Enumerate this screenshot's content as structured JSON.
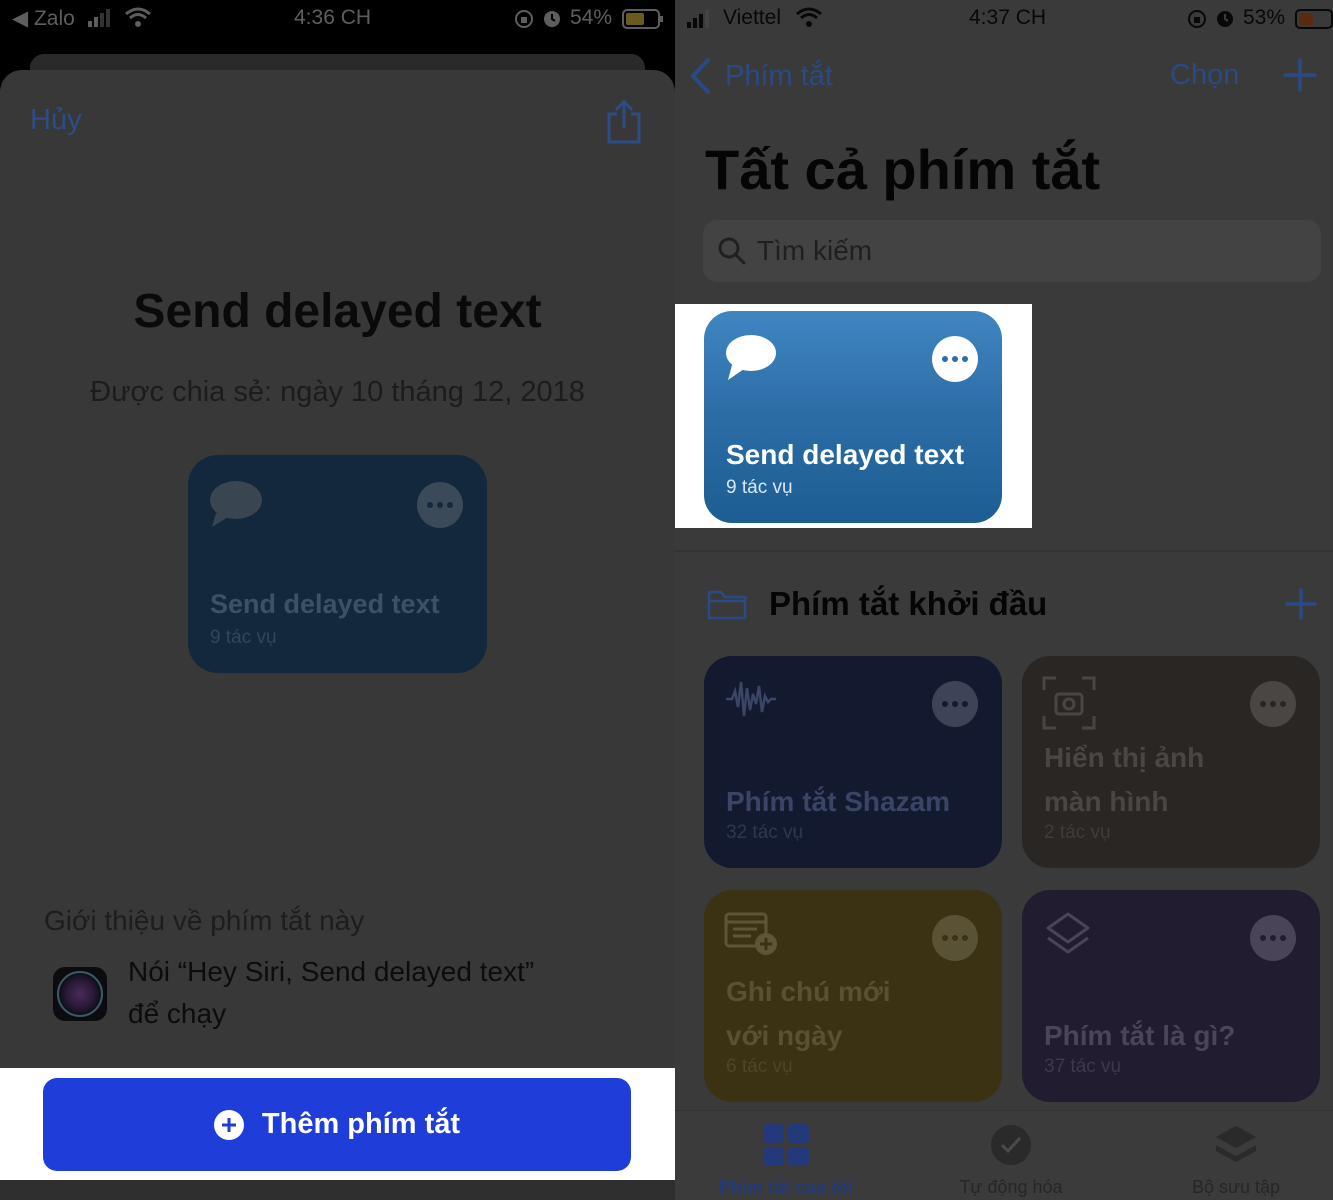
{
  "left": {
    "status": {
      "carrier": "◀ Zalo",
      "time": "4:36 CH",
      "battery": "54%"
    },
    "cancel_label": "Hủy",
    "title": "Send delayed text",
    "shared_date": "Được chia sẻ: ngày 10 tháng 12, 2018",
    "preview_card": {
      "name": "Send delayed text",
      "count": "9 tác vụ"
    },
    "about_title": "Giới thiệu về phím tắt này",
    "siri_line1": "Nói “Hey Siri, Send delayed text”",
    "siri_line2": "để chạy",
    "add_button_label": "Thêm phím tắt"
  },
  "right": {
    "status": {
      "carrier": "Viettel",
      "time": "4:37 CH",
      "battery": "53%"
    },
    "back_label": "Phím tắt",
    "select_label": "Chọn",
    "page_title": "Tất cả phím tắt",
    "search_placeholder": "Tìm kiếm",
    "main_card": {
      "name": "Send delayed text",
      "count": "9 tác vụ",
      "color": "#2e6ea8"
    },
    "starter_section_title": "Phím tắt khởi đầu",
    "starter_cards": [
      {
        "name": "Phím tắt Shazam",
        "count": "32 tác vụ",
        "icon": "waveform-icon",
        "color": "#131a30"
      },
      {
        "name_line1": "Hiển thị ảnh",
        "name_line2": "màn hình",
        "count": "2 tác vụ",
        "icon": "screenshot-icon",
        "color": "#2a2623"
      },
      {
        "name_line1": "Ghi chú mới",
        "name_line2": "với ngày",
        "count": "6 tác vụ",
        "icon": "note-add-icon",
        "color": "#3a3212"
      },
      {
        "name": "Phím tắt là gì?",
        "count": "37 tác vụ",
        "icon": "layers-icon",
        "color": "#221c30"
      }
    ],
    "tabs": [
      {
        "label": "Phím tắt của tôi",
        "icon": "grid-icon",
        "active": true
      },
      {
        "label": "Tự động hóa",
        "icon": "clock-check-icon",
        "active": false
      },
      {
        "label": "Bộ sưu tập",
        "icon": "stack-icon",
        "active": false
      }
    ]
  },
  "colors": {
    "accent": "#2a4a86",
    "add_button": "#1f3ed9",
    "highlight": "#ffffff"
  }
}
